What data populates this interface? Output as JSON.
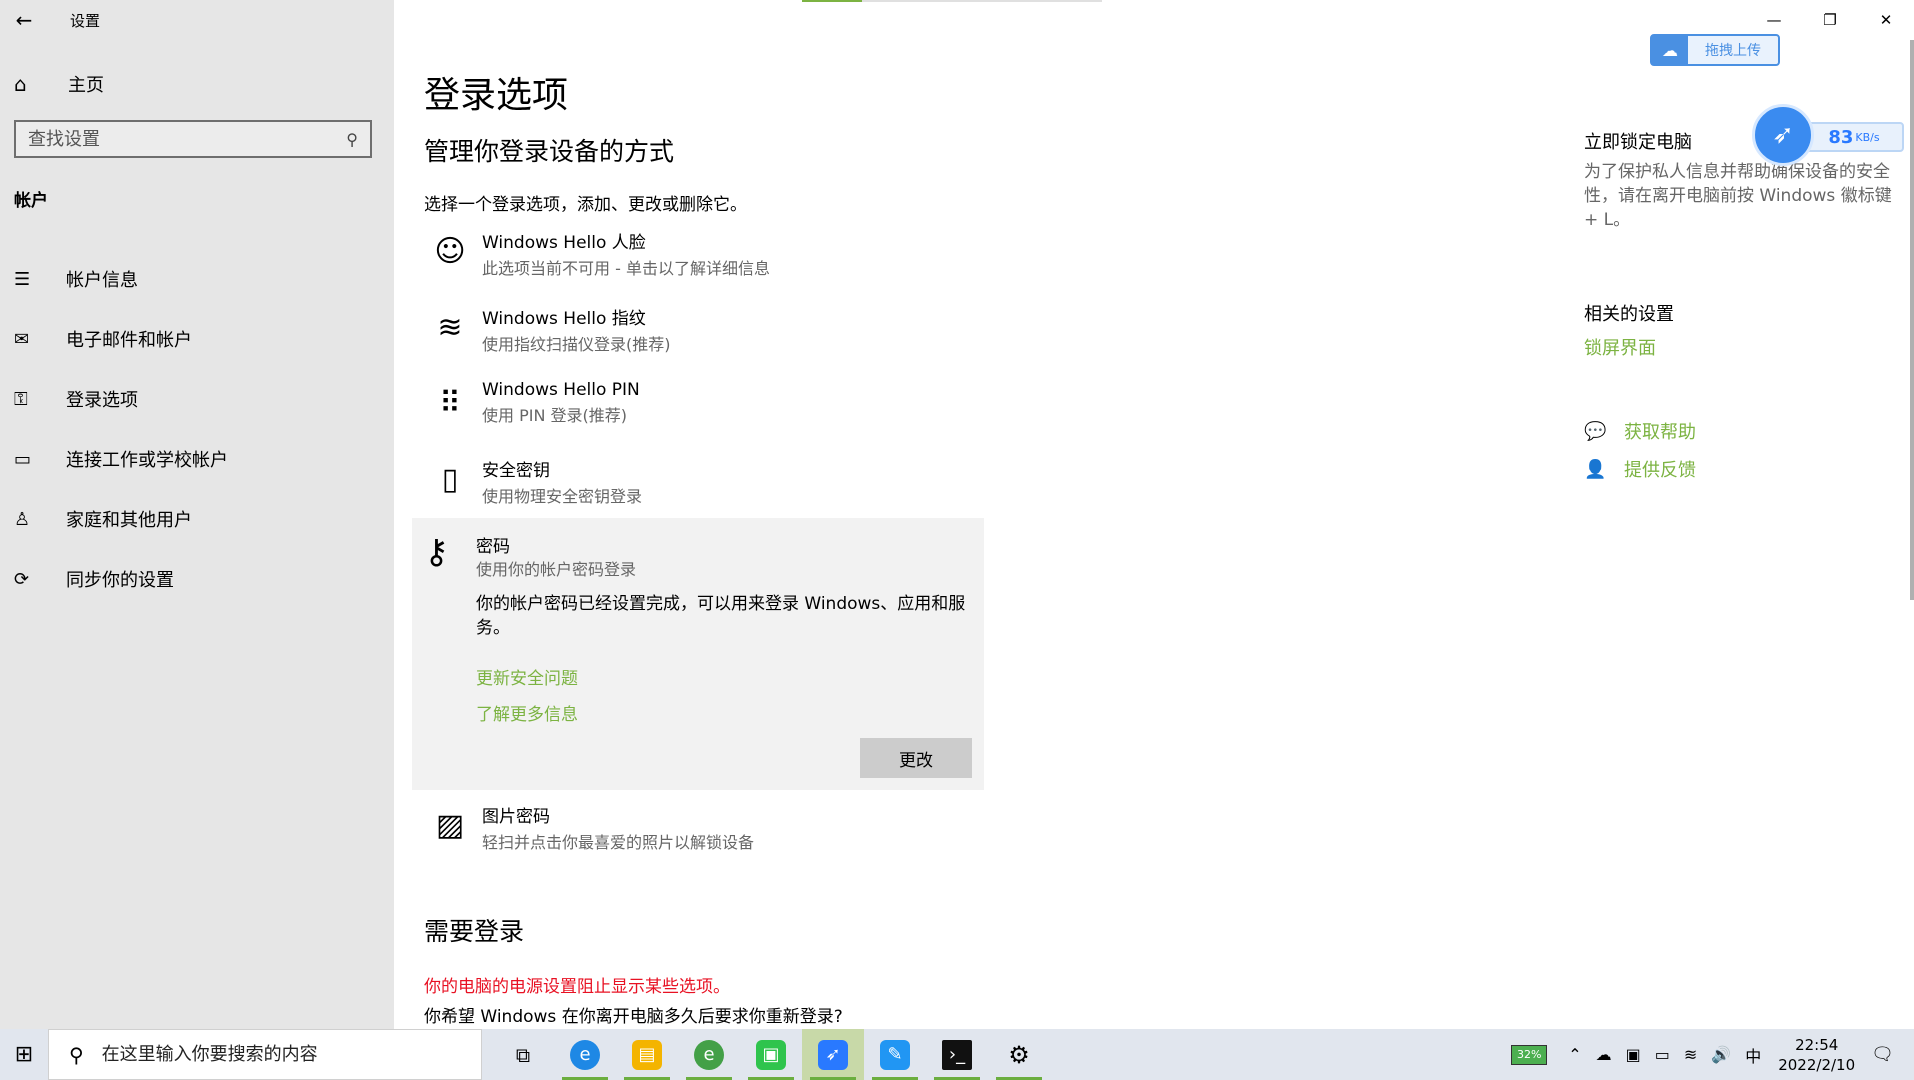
{
  "app": {
    "title": "设置"
  },
  "sidebar": {
    "home": "主页",
    "search_placeholder": "查找设置",
    "section": "帐户",
    "items": [
      {
        "label": "帐户信息",
        "icon": "account-info-icon"
      },
      {
        "label": "电子邮件和帐户",
        "icon": "mail-icon"
      },
      {
        "label": "登录选项",
        "icon": "key-icon"
      },
      {
        "label": "连接工作或学校帐户",
        "icon": "briefcase-icon"
      },
      {
        "label": "家庭和其他用户",
        "icon": "person-icon"
      },
      {
        "label": "同步你的设置",
        "icon": "sync-icon"
      }
    ]
  },
  "main": {
    "title": "登录选项",
    "subtitle": "管理你登录设备的方式",
    "intro": "选择一个登录选项，添加、更改或删除它。",
    "options": [
      {
        "name": "Windows Hello 人脸",
        "desc": "此选项当前不可用 - 单击以了解详细信息"
      },
      {
        "name": "Windows Hello 指纹",
        "desc": "使用指纹扫描仪登录(推荐)"
      },
      {
        "name": "Windows Hello PIN",
        "desc": "使用 PIN 登录(推荐)"
      },
      {
        "name": "安全密钥",
        "desc": "使用物理安全密钥登录"
      }
    ],
    "password": {
      "name": "密码",
      "desc": "使用你的帐户密码登录",
      "message": "你的帐户密码已经设置完成，可以用来登录 Windows、应用和服务。",
      "link1": "更新安全问题",
      "link2": "了解更多信息",
      "button": "更改"
    },
    "picture": {
      "name": "图片密码",
      "desc": "轻扫并点击你最喜爱的照片以解锁设备"
    },
    "require_title": "需要登录",
    "warning": "你的电脑的电源设置阻止显示某些选项。",
    "question": "你希望 Windows 在你离开电脑多久后要求你重新登录?"
  },
  "right": {
    "lock_title": "立即锁定电脑",
    "lock_desc": "为了保护私人信息并帮助确保设备的安全性，请在离开电脑前按 Windows 徽标键 + L。",
    "related_title": "相关的设置",
    "lock_screen_link": "锁屏界面",
    "help": "获取帮助",
    "feedback": "提供反馈"
  },
  "overlay": {
    "upload": "拖拽上传",
    "speed_value": "83",
    "speed_unit": "KB/s"
  },
  "taskbar": {
    "search_placeholder": "在这里输入你要搜索的内容",
    "battery": "32%",
    "ime": "中",
    "time": "22:54",
    "date": "2022/2/10"
  },
  "colors": {
    "accent": "#7cb342",
    "warning": "#e81123",
    "sidebar_bg": "#e6e6e6"
  }
}
